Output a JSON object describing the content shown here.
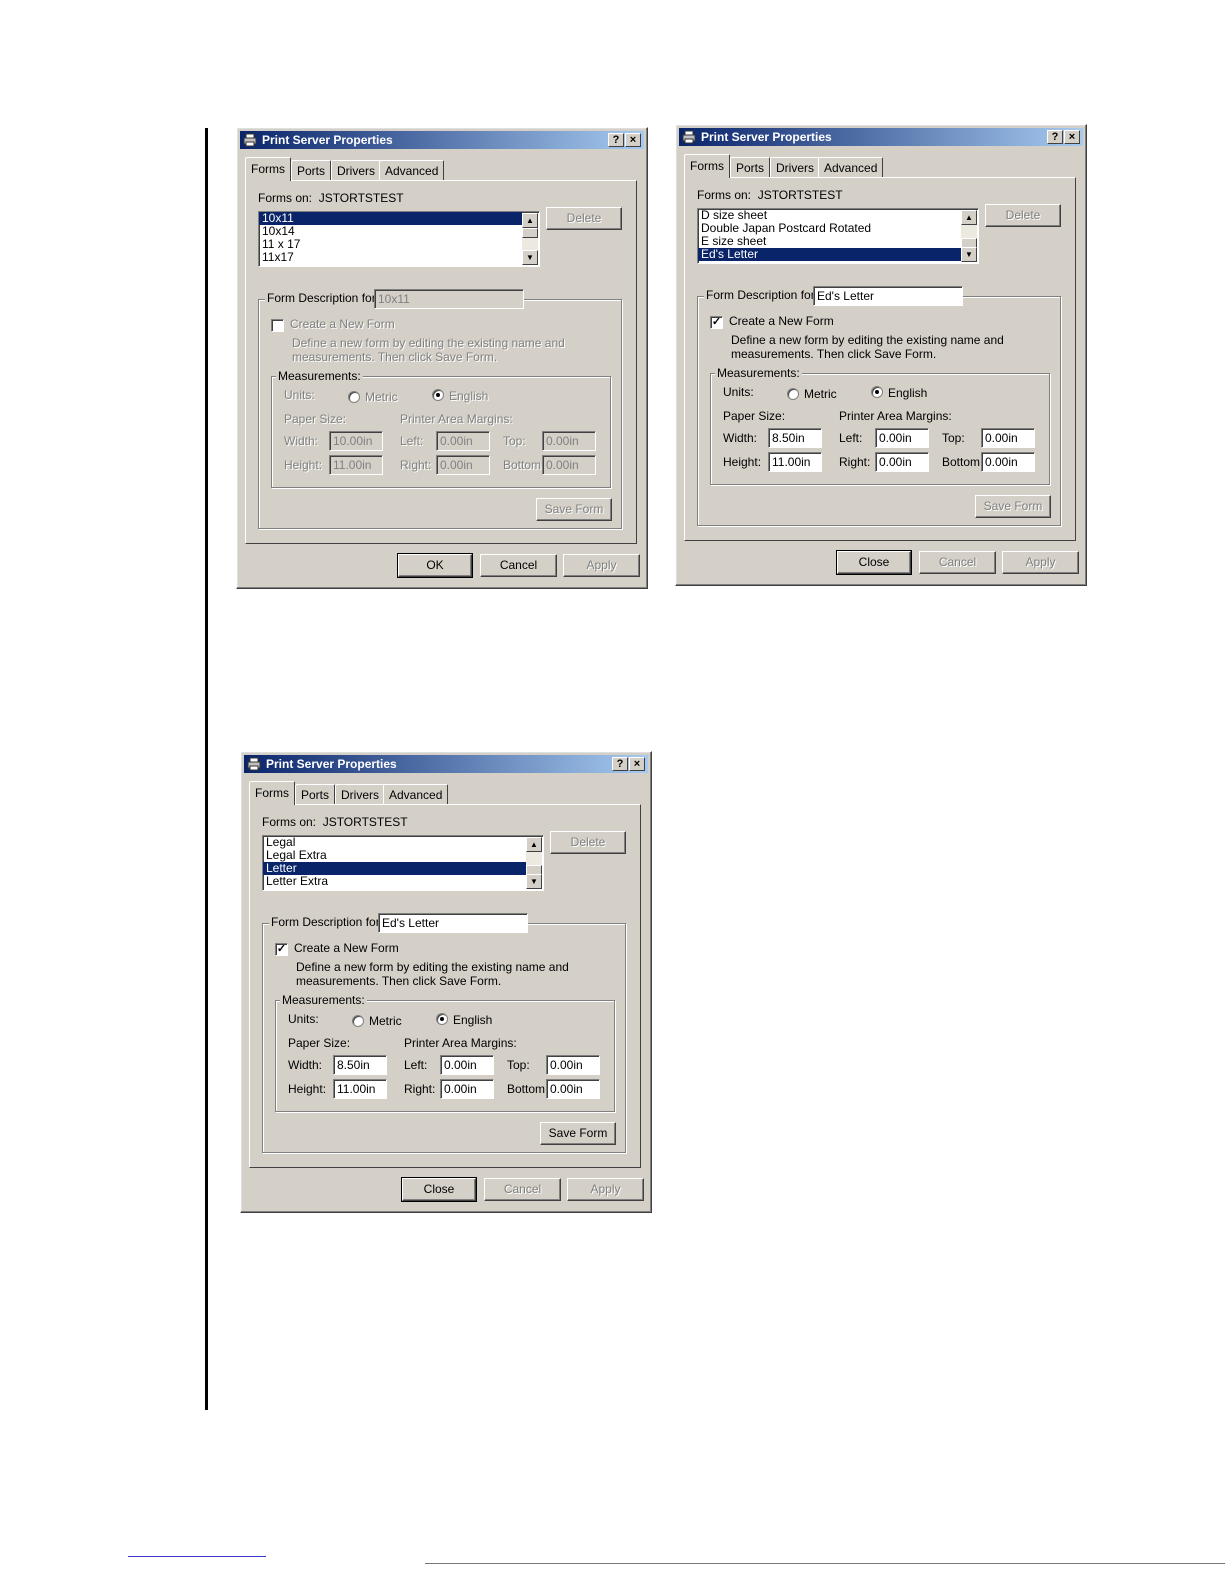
{
  "dialogs": [
    {
      "title": "Print Server Properties",
      "help_glyph": "?",
      "close_glyph": "×",
      "tabs": [
        "Forms",
        "Ports",
        "Drivers",
        "Advanced"
      ],
      "forms_on_label": "Forms on:",
      "server_name": "JSTORTSTEST",
      "forms_list": [
        "10x11",
        "10x14",
        "11 x 17",
        "11x17"
      ],
      "selected_index": 0,
      "delete_label": "Delete",
      "form_desc_label": "Form Description for:",
      "form_desc_value": "10x11",
      "create_new_form_label": "Create a New Form",
      "create_new_form_checked": false,
      "define_text_1": "Define a new form by editing the existing name and",
      "define_text_2": "measurements.  Then click Save Form.",
      "measurements_label": "Measurements:",
      "units_label": "Units:",
      "metric_label": "Metric",
      "english_label": "English",
      "paper_size_label": "Paper Size:",
      "margins_label": "Printer Area Margins:",
      "width_label": "Width:",
      "height_label": "Height:",
      "left_label": "Left:",
      "right_label": "Right:",
      "top_label": "Top:",
      "bottom_label": "Bottom:",
      "width_value": "10.00in",
      "height_value": "11.00in",
      "left_value": "0.00in",
      "right_value": "0.00in",
      "top_value": "0.00in",
      "bottom_value": "0.00in",
      "save_form_label": "Save Form",
      "buttons": [
        "OK",
        "Cancel",
        "Apply"
      ],
      "enabled": false
    },
    {
      "title": "Print Server Properties",
      "help_glyph": "?",
      "close_glyph": "×",
      "tabs": [
        "Forms",
        "Ports",
        "Drivers",
        "Advanced"
      ],
      "forms_on_label": "Forms on:",
      "server_name": "JSTORTSTEST",
      "forms_list": [
        "D size sheet",
        "Double Japan Postcard Rotated",
        "E size sheet",
        "Ed's Letter"
      ],
      "selected_index": 3,
      "delete_label": "Delete",
      "form_desc_label": "Form Description for:",
      "form_desc_value": "Ed's Letter",
      "create_new_form_label": "Create a New Form",
      "create_new_form_checked": true,
      "define_text_1": "Define a new form by editing the existing name and",
      "define_text_2": "measurements.  Then click Save Form.",
      "measurements_label": "Measurements:",
      "units_label": "Units:",
      "metric_label": "Metric",
      "english_label": "English",
      "paper_size_label": "Paper Size:",
      "margins_label": "Printer Area Margins:",
      "width_label": "Width:",
      "height_label": "Height:",
      "left_label": "Left:",
      "right_label": "Right:",
      "top_label": "Top:",
      "bottom_label": "Bottom:",
      "width_value": "8.50in",
      "height_value": "11.00in",
      "left_value": "0.00in",
      "right_value": "0.00in",
      "top_value": "0.00in",
      "bottom_value": "0.00in",
      "save_form_label": "Save Form",
      "buttons": [
        "Close",
        "Cancel",
        "Apply"
      ],
      "enabled": true
    },
    {
      "title": "Print Server Properties",
      "help_glyph": "?",
      "close_glyph": "×",
      "tabs": [
        "Forms",
        "Ports",
        "Drivers",
        "Advanced"
      ],
      "forms_on_label": "Forms on:",
      "server_name": "JSTORTSTEST",
      "forms_list": [
        "Legal",
        "Legal Extra",
        "Letter",
        "Letter Extra"
      ],
      "selected_index": 2,
      "delete_label": "Delete",
      "form_desc_label": "Form Description for:",
      "form_desc_value": "Ed's Letter",
      "create_new_form_label": "Create a New Form",
      "create_new_form_checked": true,
      "define_text_1": "Define a new form by editing the existing name and",
      "define_text_2": "measurements.  Then click Save Form.",
      "measurements_label": "Measurements:",
      "units_label": "Units:",
      "metric_label": "Metric",
      "english_label": "English",
      "paper_size_label": "Paper Size:",
      "margins_label": "Printer Area Margins:",
      "width_label": "Width:",
      "height_label": "Height:",
      "left_label": "Left:",
      "right_label": "Right:",
      "top_label": "Top:",
      "bottom_label": "Bottom:",
      "width_value": "8.50in",
      "height_value": "11.00in",
      "left_value": "0.00in",
      "right_value": "0.00in",
      "top_value": "0.00in",
      "bottom_value": "0.00in",
      "save_form_label": "Save Form",
      "buttons": [
        "Close",
        "Cancel",
        "Apply"
      ],
      "enabled": true
    }
  ]
}
